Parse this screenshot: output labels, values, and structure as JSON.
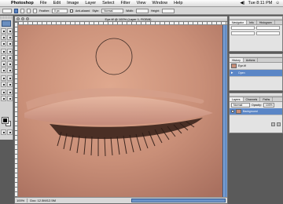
{
  "menubar": {
    "apple_glyph": "",
    "items": [
      "Photoshop",
      "File",
      "Edit",
      "Image",
      "Layer",
      "Select",
      "Filter",
      "View",
      "Window",
      "Help"
    ],
    "clock": "Tue 8:11 PM"
  },
  "options_bar": {
    "feather_label": "Feather:",
    "feather_value": "0 px",
    "style_label": "Style:",
    "style_value": "Normal",
    "width_label": "Width:",
    "height_label": "Height:",
    "antialias_label": "Anti-aliased"
  },
  "document": {
    "title": "Eye.tif @ 100% (Layer 1, RGB/8)",
    "zoom": "100%",
    "doc_info": "Doc: 12.5M/12.5M"
  },
  "navigator_palette": {
    "tabs": [
      "Navigator",
      "Info",
      "Histogram"
    ]
  },
  "history_palette": {
    "tabs": [
      "History",
      "Actions"
    ],
    "items": [
      "Eye.tif",
      "Open"
    ]
  },
  "layers_palette": {
    "tabs": [
      "Layers",
      "Channels",
      "Paths"
    ],
    "blend_mode": "Normal",
    "opacity_label": "Opacity:",
    "opacity_value": "100%",
    "layers": [
      "Background"
    ]
  },
  "colors": {
    "skin": "#c98f78",
    "selection_blue": "#5b86c6"
  }
}
